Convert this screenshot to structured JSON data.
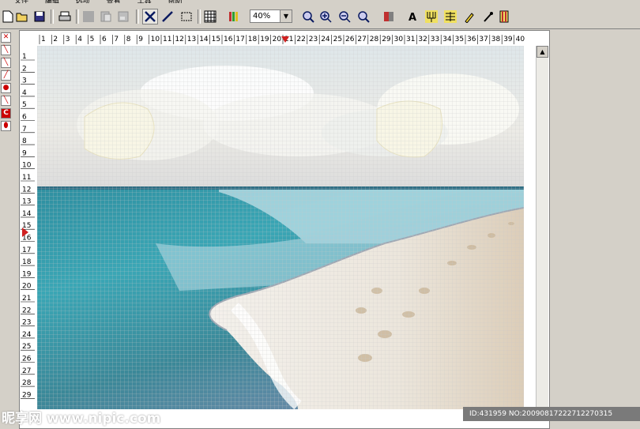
{
  "menubar": {
    "items": [
      "文件",
      "编辑",
      "选项",
      "查看",
      "工具",
      "帮助"
    ]
  },
  "toolbar": {
    "zoom_value": "40%",
    "buttons": [
      "new-icon",
      "open-icon",
      "save-icon",
      "print-icon",
      "copy-icon",
      "paste-icon",
      "paste2-icon",
      "cross-stitch-icon",
      "back-stitch-icon",
      "select-icon",
      "grid-icon",
      "palette-icon",
      "zoom-in-icon",
      "zoom-plus-icon",
      "zoom-minus-icon",
      "zoom-fit-icon",
      "colors-icon",
      "text-icon",
      "fork-icon",
      "list-icon",
      "brush-icon",
      "dropper-icon",
      "thread-icon"
    ]
  },
  "ruler": {
    "h_labels": [
      "1",
      "2",
      "3",
      "4",
      "5",
      "6",
      "7",
      "8",
      "9",
      "10",
      "11",
      "12",
      "13",
      "14",
      "15",
      "16",
      "17",
      "18",
      "19",
      "20",
      "21",
      "22",
      "23",
      "24",
      "25",
      "26",
      "27",
      "28",
      "29",
      "30",
      "31",
      "32",
      "33",
      "34",
      "35",
      "36",
      "37",
      "38",
      "39",
      "40"
    ],
    "v_labels": [
      "1",
      "2",
      "3",
      "4",
      "5",
      "6",
      "7",
      "8",
      "9",
      "10",
      "11",
      "12",
      "13",
      "14",
      "15",
      "16",
      "17",
      "18",
      "19",
      "20",
      "21",
      "22",
      "23",
      "24",
      "25",
      "26",
      "27",
      "28",
      "29"
    ]
  },
  "watermark": {
    "left": "昵享网 www.nipic.com",
    "right": "ID:431959 NO:20090817222712270315"
  }
}
